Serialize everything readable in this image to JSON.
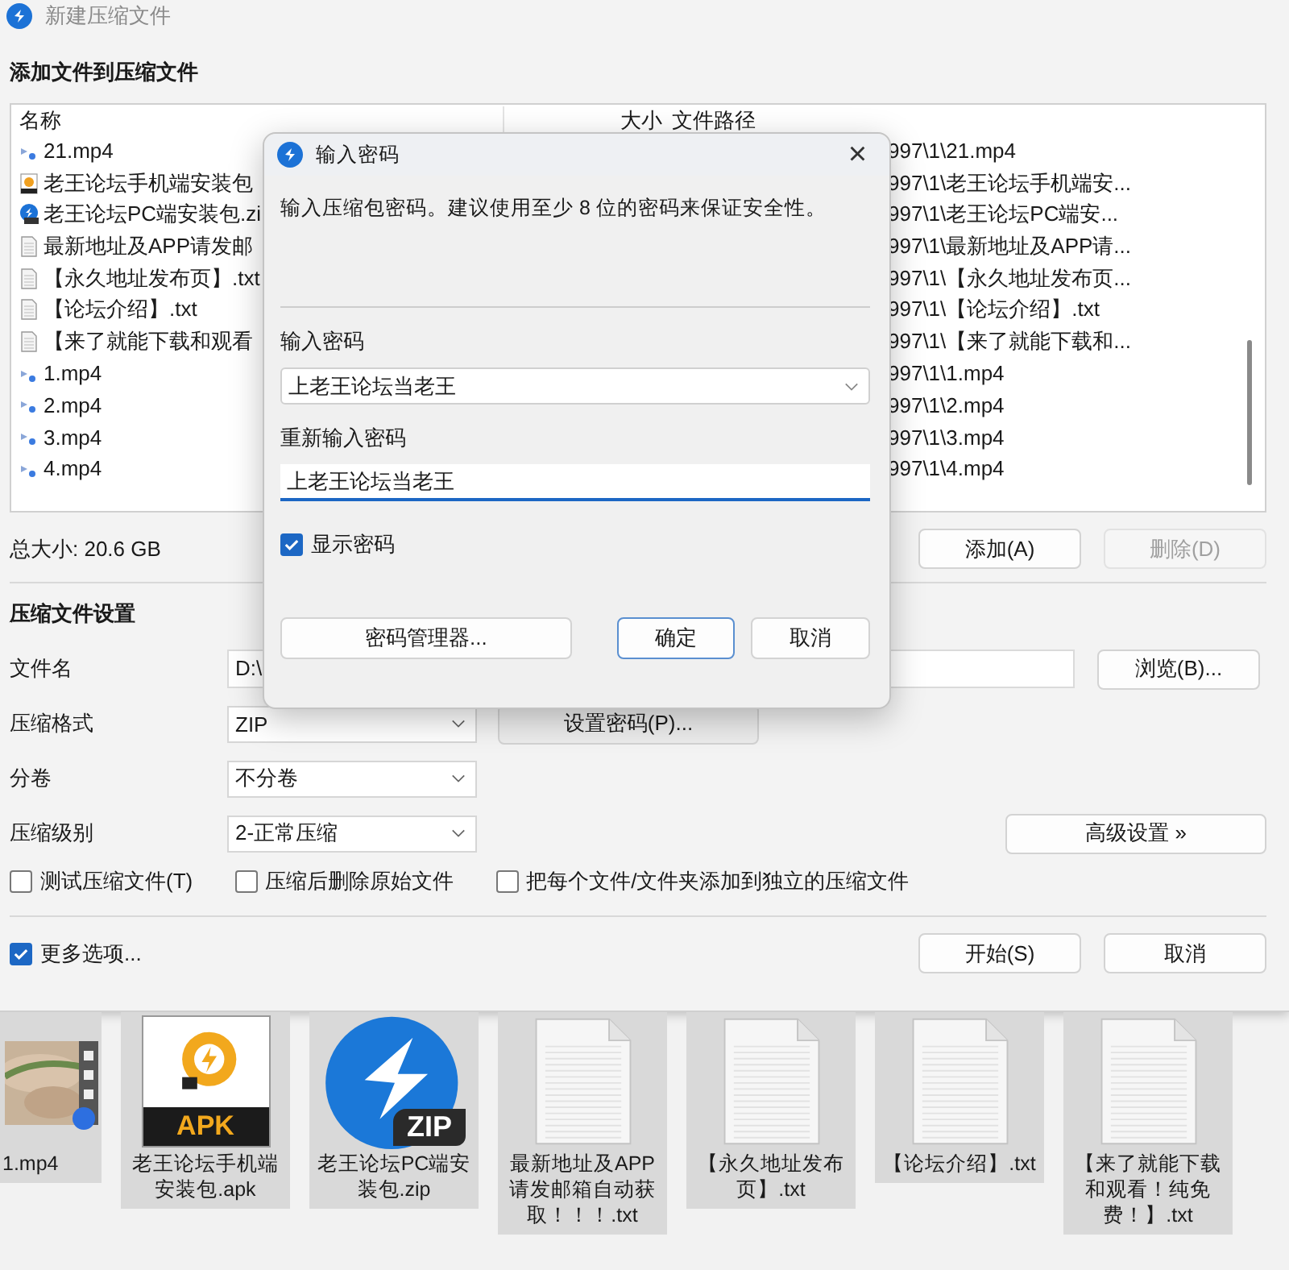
{
  "window": {
    "title": "新建压缩文件"
  },
  "files_section": {
    "heading": "添加文件到压缩文件",
    "columns": [
      "名称",
      "大小",
      "文件路径"
    ],
    "rows": [
      {
        "kind": "video",
        "name": "21.mp4",
        "path": "997\\1\\21.mp4"
      },
      {
        "kind": "apk",
        "name": "老王论坛手机端安装包",
        "path": "997\\1\\老王论坛手机端安..."
      },
      {
        "kind": "zip",
        "name": "老王论坛PC端安装包.zi",
        "path": "997\\1\\老王论坛PC端安..."
      },
      {
        "kind": "text",
        "name": "最新地址及APP请发邮",
        "path": "997\\1\\最新地址及APP请..."
      },
      {
        "kind": "text",
        "name": "【永久地址发布页】.txt",
        "path": "997\\1\\【永久地址发布页..."
      },
      {
        "kind": "text",
        "name": "【论坛介绍】.txt",
        "path": "997\\1\\【论坛介绍】.txt"
      },
      {
        "kind": "text",
        "name": "【来了就能下载和观看",
        "path": "997\\1\\【来了就能下载和..."
      },
      {
        "kind": "video",
        "name": "1.mp4",
        "path": "997\\1\\1.mp4"
      },
      {
        "kind": "video",
        "name": "2.mp4",
        "path": "997\\1\\2.mp4"
      },
      {
        "kind": "video",
        "name": "3.mp4",
        "path": "997\\1\\3.mp4"
      },
      {
        "kind": "video",
        "name": "4.mp4",
        "path": "997\\1\\4.mp4"
      }
    ]
  },
  "total_size": "总大小: 20.6 GB",
  "file_buttons": [
    {
      "label": "添加(A)",
      "disabled": false
    },
    {
      "label": "删除(D)",
      "disabled": true
    }
  ],
  "settings": {
    "heading": "压缩文件设置",
    "filename": {
      "label": "文件名",
      "value": "D:\\"
    },
    "browse_button": "浏览(B)...",
    "format": {
      "label": "压缩格式",
      "value": "ZIP"
    },
    "set_password_button": "设置密码(P)...",
    "split": {
      "label": "分卷",
      "value": "不分卷"
    },
    "level": {
      "label": "压缩级别",
      "value": "2-正常压缩"
    },
    "advanced_button": "高级设置 »",
    "options": [
      {
        "label": "测试压缩文件(T)",
        "checked": false
      },
      {
        "label": "压缩后删除原始文件",
        "checked": false
      },
      {
        "label": "把每个文件/文件夹添加到独立的压缩文件",
        "checked": false
      }
    ]
  },
  "more_options": {
    "label": "更多选项...",
    "checked": true
  },
  "buttons": [
    {
      "label": "开始(S)"
    },
    {
      "label": "取消"
    }
  ],
  "dialog": {
    "title": "输入密码",
    "close": "×",
    "description": "输入压缩包密码。建议使用至少 8 位的密码来保证安全性。",
    "password_label": "输入密码",
    "password": "上老王论坛当老王",
    "confirm_label": "重新输入密码",
    "confirm": "上老王论坛当老王",
    "show_password": {
      "label": "显示密码",
      "checked": true
    },
    "buttons": [
      {
        "label": "密码管理器...",
        "default": false
      },
      {
        "label": "确定",
        "default": true
      },
      {
        "label": "取消",
        "default": false
      }
    ]
  },
  "desktop": {
    "items": [
      {
        "kind": "video",
        "label": "1.mp4"
      },
      {
        "kind": "apk",
        "badge": "APK",
        "label": "老王论坛手机端安装包.apk"
      },
      {
        "kind": "zip",
        "badge": "ZIP",
        "label": "老王论坛PC端安装包.zip"
      },
      {
        "kind": "text",
        "label": "最新地址及APP请发邮箱自动获取！！！.txt"
      },
      {
        "kind": "text",
        "label": "【永久地址发布页】.txt"
      },
      {
        "kind": "text",
        "label": "【论坛介绍】.txt"
      },
      {
        "kind": "text",
        "label": "【来了就能下载和观看！纯免费！】.txt"
      }
    ]
  }
}
